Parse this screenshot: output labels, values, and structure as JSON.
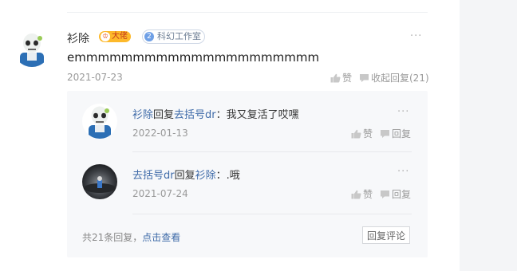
{
  "main_comment": {
    "user_name": "衫除",
    "badge_dalao": "大佬",
    "badge_dalao_icon": "crown-icon",
    "badge_studio_number": "2",
    "badge_studio_label": "科幻工作室",
    "text": "emmmmmmmmmmmmmmmmmmmmm",
    "date": "2021-07-23",
    "like_label": "赞",
    "collapse_label": "收起回复(21)"
  },
  "replies": [
    {
      "from_user": "衫除",
      "reply_word": "回复",
      "to_user": "去括号dr",
      "text": "：我又复活了哎嘿",
      "date": "2022-01-13",
      "like_label": "赞",
      "reply_label": "回复"
    },
    {
      "from_user": "去括号dr",
      "reply_word": "回复",
      "to_user": "衫除",
      "text": "：.哦",
      "date": "2021-07-24",
      "like_label": "赞",
      "reply_label": "回复"
    }
  ],
  "footer": {
    "count_text": "共21条回复，",
    "view_link": "点击查看",
    "reply_button": "回复评论"
  },
  "colors": {
    "link": "#3e6aa8",
    "badge_gold": "#fdb92b",
    "reply_bg": "#f7f8fa"
  }
}
